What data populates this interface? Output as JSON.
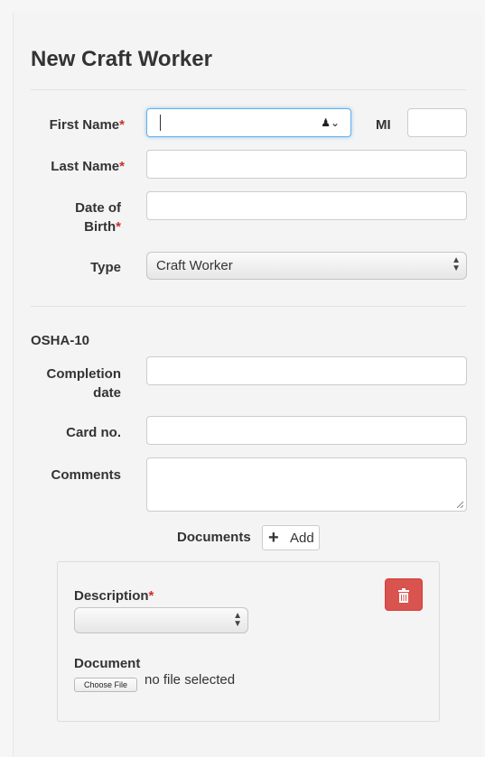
{
  "form": {
    "title": "New Craft Worker",
    "required_marker": "*",
    "first_name": {
      "label": "First Name",
      "value": ""
    },
    "mi": {
      "label": "MI",
      "value": ""
    },
    "last_name": {
      "label": "Last Name",
      "value": ""
    },
    "dob": {
      "label_line1": "Date of",
      "label_line2": "Birth",
      "value": ""
    },
    "type": {
      "label": "Type",
      "value": "Craft Worker"
    }
  },
  "osha": {
    "heading": "OSHA-10",
    "completion": {
      "label_line1": "Completion",
      "label_line2": "date",
      "value": ""
    },
    "card": {
      "label": "Card no.",
      "value": ""
    },
    "comments": {
      "label": "Comments",
      "value": ""
    }
  },
  "documents": {
    "label": "Documents",
    "add_label": "Add",
    "description_label": "Description",
    "description_value": "",
    "document_label": "Document",
    "choose_file_label": "Choose File",
    "file_status": "no file selected"
  },
  "icons": {
    "contact_autofill": "contact-card-icon",
    "add": "plus-icon",
    "delete": "trash-icon"
  },
  "colors": {
    "required": "#c9302c",
    "delete_button": "#d9534f",
    "focus_border": "#66afe9"
  }
}
